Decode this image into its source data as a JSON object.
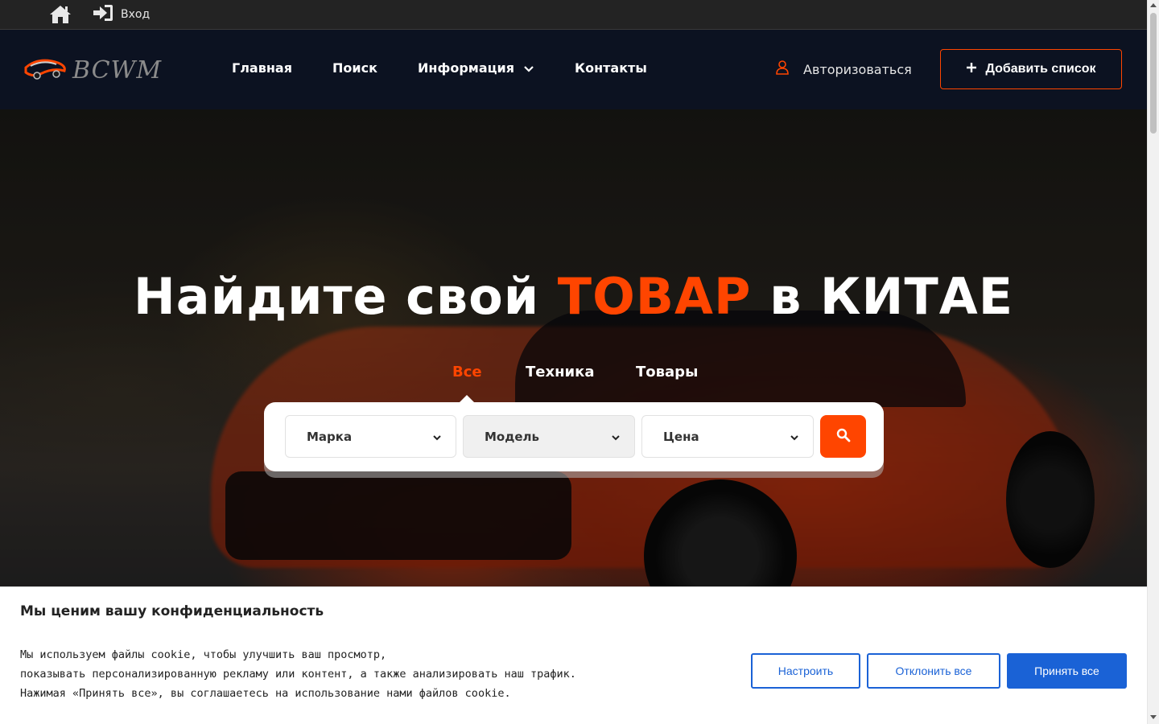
{
  "topbar": {
    "login_label": "Вход"
  },
  "header": {
    "logo_text": "BCWM",
    "nav": {
      "home": "Главная",
      "search": "Поиск",
      "info": "Информация",
      "contacts": "Контакты"
    },
    "auth_label": "Авторизоваться",
    "add_listing_label": "Добавить список"
  },
  "hero": {
    "headline_part1": "Найдите свой",
    "headline_accent": "ТОВАР",
    "headline_part2": "в КИТАЕ",
    "tabs": [
      "Все",
      "Техника",
      "Товары"
    ],
    "selected_tab": "Все",
    "search": {
      "brand": "Марка",
      "model": "Модель",
      "price": "Цена"
    }
  },
  "cookie": {
    "title": "Мы ценим вашу конфиденциальность",
    "lines": [
      "Мы используем файлы cookie, чтобы улучшить ваш просмотр,",
      "показывать персонализированную рекламу или контент, а также анализировать наш трафик.",
      "Нажимая «Принять все», вы соглашаетесь на использование нами файлов cookie."
    ],
    "customize": "Настроить",
    "reject_all": "Отклонить все",
    "accept_all": "Принять все"
  },
  "colors": {
    "accent": "#ff4500",
    "header_bg": "#0c1221",
    "topbar_bg": "#232323",
    "cookie_button": "#1a62d6"
  },
  "icons": [
    "home-icon",
    "login-icon",
    "user-icon",
    "plus-icon",
    "chevron-down-icon",
    "search-icon"
  ]
}
